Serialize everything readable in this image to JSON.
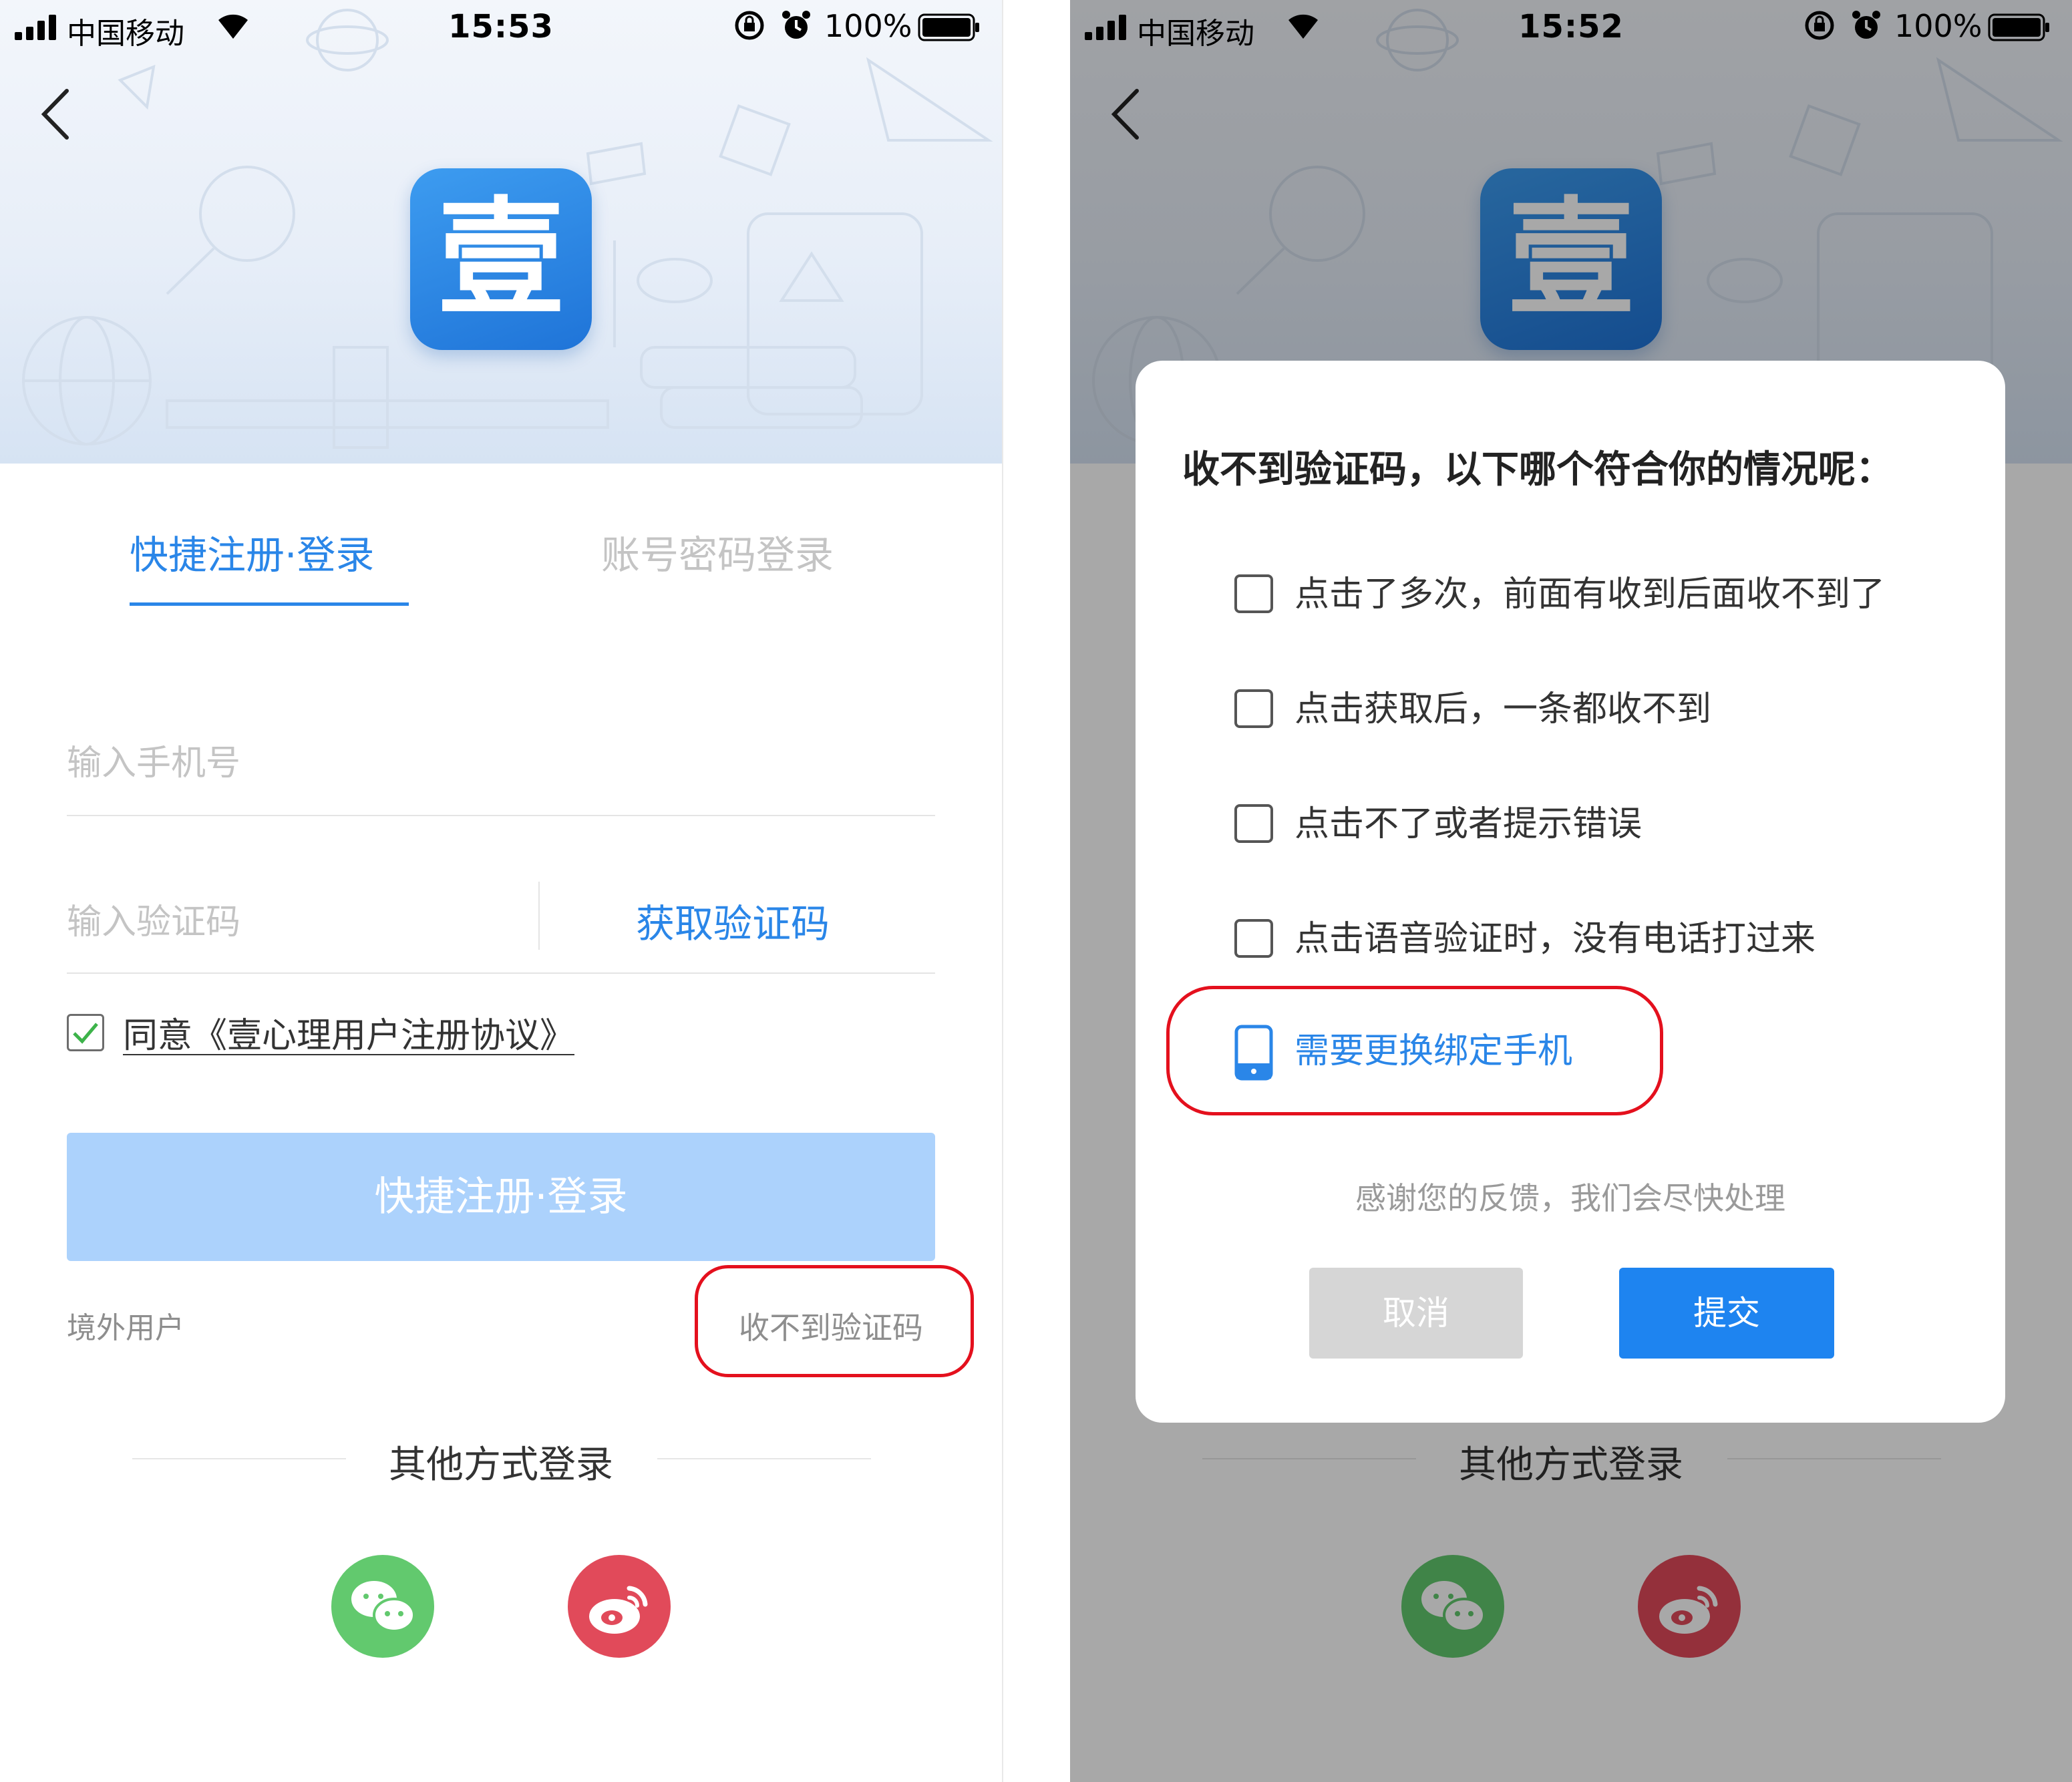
{
  "left_screen": {
    "status_bar": {
      "carrier": "中国移动",
      "time": "15:53",
      "battery": "100%"
    },
    "logo_char": "壹",
    "tabs": {
      "active": "快捷注册·登录",
      "inactive": "账号密码登录"
    },
    "phone_input": {
      "placeholder": "输入手机号"
    },
    "code_input": {
      "placeholder": "输入验证码"
    },
    "get_code_label": "获取验证码",
    "agreement": {
      "checked": true,
      "label": "同意《壹心理用户注册协议》"
    },
    "login_button": "快捷注册·登录",
    "overseas_link": "境外用户",
    "no_code_link": "收不到验证码",
    "other_login_title": "其他方式登录",
    "social": [
      {
        "icon": "wechat-icon"
      },
      {
        "icon": "weibo-icon"
      }
    ]
  },
  "right_screen": {
    "status_bar": {
      "carrier": "中国移动",
      "time": "15:52",
      "battery": "100%"
    },
    "logo_char": "壹",
    "other_login_title": "其他方式登录",
    "dialog": {
      "title": "收不到验证码，以下哪个符合你的情况呢：",
      "options": [
        {
          "label": "点击了多次，前面有收到后面收不到了",
          "checked": false
        },
        {
          "label": "点击获取后，一条都收不到",
          "checked": false
        },
        {
          "label": "点击不了或者提示错误",
          "checked": false
        },
        {
          "label": "点击语音验证时，没有电话打过来",
          "checked": false
        }
      ],
      "change_phone_label": "需要更换绑定手机",
      "thanks_text": "感谢您的反馈，我们会尽快处理",
      "cancel_label": "取消",
      "submit_label": "提交"
    }
  },
  "colors": {
    "accent": "#2a86e8",
    "button_disabled": "#acd2fc",
    "submit": "#1e84f0",
    "highlight": "#e4101d",
    "wechat": "#62c96e",
    "weibo": "#e14a5a"
  }
}
